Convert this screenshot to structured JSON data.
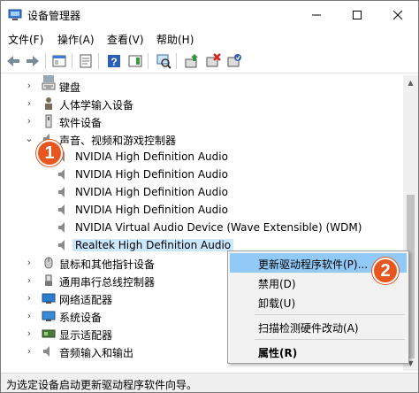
{
  "window": {
    "title": "设备管理器"
  },
  "menu": [
    {
      "label": "文件(F)"
    },
    {
      "label": "操作(A)"
    },
    {
      "label": "查看(V)"
    },
    {
      "label": "帮助(H)"
    }
  ],
  "tree": {
    "categories_top": [
      {
        "label": "键盘",
        "icon": "keyboard-icon"
      },
      {
        "label": "人体学输入设备",
        "icon": "hid-icon"
      },
      {
        "label": "软件设备",
        "icon": "software-device-icon"
      },
      {
        "label": "声音、视频和游戏控制器",
        "icon": "sound-icon"
      }
    ],
    "audio_devices": [
      {
        "label": "NVIDIA High Definition Audio"
      },
      {
        "label": "NVIDIA High Definition Audio"
      },
      {
        "label": "NVIDIA High Definition Audio"
      },
      {
        "label": "NVIDIA High Definition Audio"
      },
      {
        "label": "NVIDIA Virtual Audio Device (Wave Extensible) (WDM)"
      },
      {
        "label": "Realtek High Definition Audio"
      }
    ],
    "categories_bottom": [
      {
        "label": "鼠标和其他指针设备",
        "icon": "mouse-icon"
      },
      {
        "label": "通用串行总线控制器",
        "icon": "usb-icon"
      },
      {
        "label": "网络适配器",
        "icon": "network-adapter-icon"
      },
      {
        "label": "系统设备",
        "icon": "system-device-icon"
      },
      {
        "label": "显示适配器",
        "icon": "display-adapter-icon"
      },
      {
        "label": "音频输入和输出",
        "icon": "audio-io-icon"
      }
    ]
  },
  "context_menu": {
    "items": [
      {
        "label": "更新驱动程序软件(P)..."
      },
      {
        "label": "禁用(D)"
      },
      {
        "label": "卸载(U)"
      },
      {
        "label": "扫描检测硬件改动(A)"
      },
      {
        "label": "属性(R)"
      }
    ]
  },
  "badges": {
    "first": "1",
    "second": "2"
  },
  "status": {
    "text": "为选定设备启动更新驱动程序软件向导。"
  },
  "colors": {
    "badge": "#e8561f",
    "highlight": "#91c9f7",
    "selection": "#cce8ff"
  }
}
